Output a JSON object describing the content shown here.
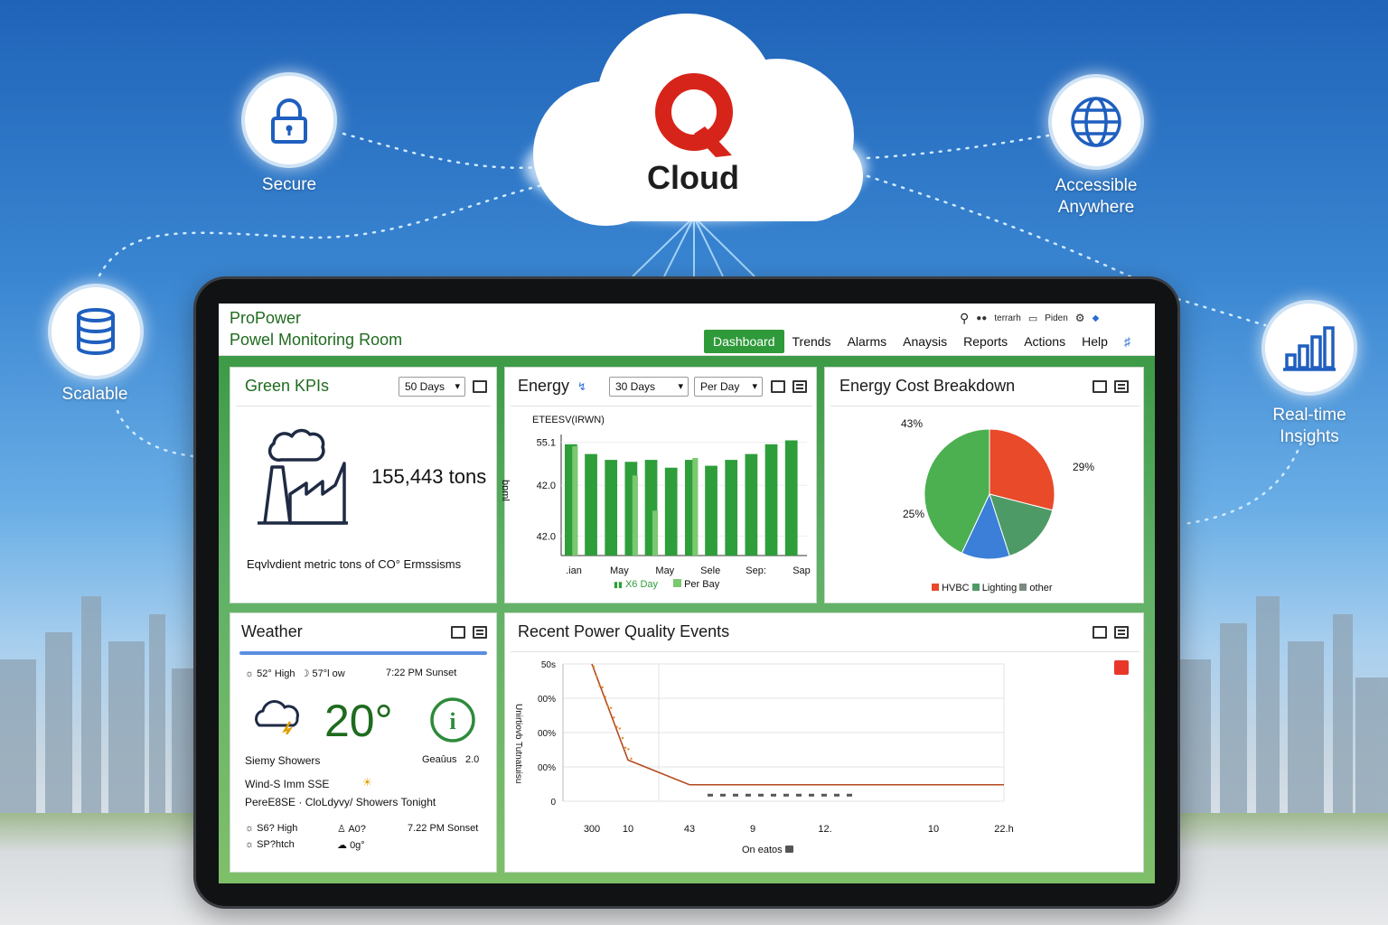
{
  "cloud": {
    "name": "Cloud"
  },
  "features": {
    "secure": "Secure",
    "scalable": "Scalable",
    "accessible_1": "Accessible",
    "accessible_2": "Anywhere",
    "realtime_1": "Real-time",
    "realtime_2": "Insights"
  },
  "app": {
    "brand_line1": "ProPower",
    "brand_line2": "Powel Monitoring Room",
    "util": {
      "user1": "terrarh",
      "user2": "Piden"
    },
    "nav": [
      "Dashboard",
      "Trends",
      "Alarms",
      "Anaysis",
      "Reports",
      "Actions",
      "Help"
    ]
  },
  "green_kpis": {
    "title": "Green KPIs",
    "range": "50 Days",
    "value": "155,443 tons",
    "caption": "Eqvlvdient metric tons of CO° Ermssisms"
  },
  "energy": {
    "title": "Energy",
    "range": "30 Days",
    "period": "Per Day",
    "chart_title": "ETEESV(IRWN)",
    "ylabel": "bɒml",
    "legend1": "X6 Day",
    "legend2": "Per Bay"
  },
  "cost": {
    "title": "Energy Cost Breakdown",
    "legend": [
      "HVBC",
      "Lighting",
      "other"
    ]
  },
  "weather": {
    "title": "Weather",
    "row1_high": "52° High",
    "row1_low": "57°l ow",
    "row1_sunset": "7:22 PM Sunset",
    "temp": "20°",
    "condition": "Siemy Showers",
    "gauge_label": "Geaûus",
    "gauge_value": "2.0",
    "wind": "Wind-S Imm SSE",
    "forecast": "PereE8SE · CloLdyvy/ Showers Tonight",
    "row3_high": "S6? High",
    "row3_aq": "A0?",
    "row3_sunset": "7.22 PM Sonset",
    "row4_a": "SP?htch",
    "row4_b": "0g°"
  },
  "events": {
    "title": "Recent Power Quality Events",
    "ylabel": "Unirtiovb Tutnatuisu",
    "xlabel": "On eatos"
  },
  "chart_data": [
    {
      "type": "bar",
      "title": "ETEESV(IRWN)",
      "ylabel": "bɒml",
      "y_tick_labels": [
        "55.1",
        "42.0",
        "42.0"
      ],
      "x_tick_labels": [
        ".ian",
        "May",
        "May",
        "Sele",
        "Sep:",
        "Sap"
      ],
      "series": [
        {
          "name": "X6 Day",
          "values": [
            57,
            52,
            49,
            48,
            49,
            45,
            49,
            46,
            49,
            52,
            57,
            59
          ]
        },
        {
          "name": "Per Bay",
          "values": [
            56,
            null,
            null,
            41,
            23,
            null,
            50,
            null,
            null,
            null,
            null,
            null
          ]
        }
      ],
      "colors": [
        "#2e9e3a",
        "#7ac86f"
      ]
    },
    {
      "type": "pie",
      "title": "Energy Cost Breakdown",
      "slices": [
        {
          "label": "HVBC",
          "value": 29,
          "color": "#e84a2a"
        },
        {
          "label": "other",
          "value": 16,
          "color": "#4e9a66"
        },
        {
          "label": "Lighting",
          "value": 12,
          "color": "#3b7fd8"
        },
        {
          "label": "",
          "value": 43,
          "color": "#4caf50"
        }
      ],
      "printed_labels": [
        "43%",
        "29%",
        "25%"
      ]
    },
    {
      "type": "line",
      "title": "Recent Power Quality Events",
      "ylabel": "Unirtiovb Tutnatuisu",
      "xlabel": "On eatos",
      "y_tick_labels": [
        "50s",
        "00%",
        "00%",
        "00%",
        "0"
      ],
      "x_tick_labels": [
        "300",
        "10",
        "43",
        "9",
        "12.",
        "10",
        "22.h"
      ],
      "series": [
        {
          "values": [
            100,
            30,
            12,
            12,
            12,
            12,
            12
          ]
        }
      ],
      "colors": [
        "#b34a1e"
      ]
    }
  ]
}
